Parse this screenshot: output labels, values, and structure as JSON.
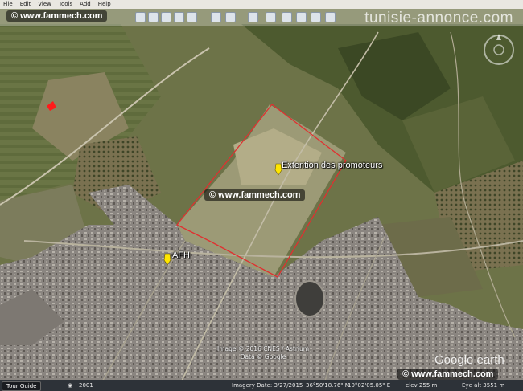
{
  "menu": [
    "File",
    "Edit",
    "View",
    "Tools",
    "Add",
    "Help"
  ],
  "watermarks": {
    "top_left": "© www.fammech.com",
    "center": "© www.fammech.com",
    "bottom_right": "© www.fammech.com",
    "site": "tunisie-annonce.com"
  },
  "placemarks": {
    "promoteurs": "Extention des promoteurs",
    "afh": "AFH"
  },
  "imagery_credit": {
    "line1": "Image © 2016 CNES / Astrium",
    "line2": "Data © Google"
  },
  "logo": "Google earth",
  "status": {
    "tour_guide": "Tour Guide",
    "year": "2001",
    "imagery_date": "Imagery Date: 3/27/2015",
    "latitude": "36°50'18.76\" N",
    "longitude": "10°02'05.05\" E",
    "elevation": "elev 255 m",
    "eye_alt": "Eye alt 3551 m"
  },
  "colors": {
    "boundary": "#e03030",
    "placemark_pin": "#ffe600",
    "marker": "#ff1a1a"
  }
}
